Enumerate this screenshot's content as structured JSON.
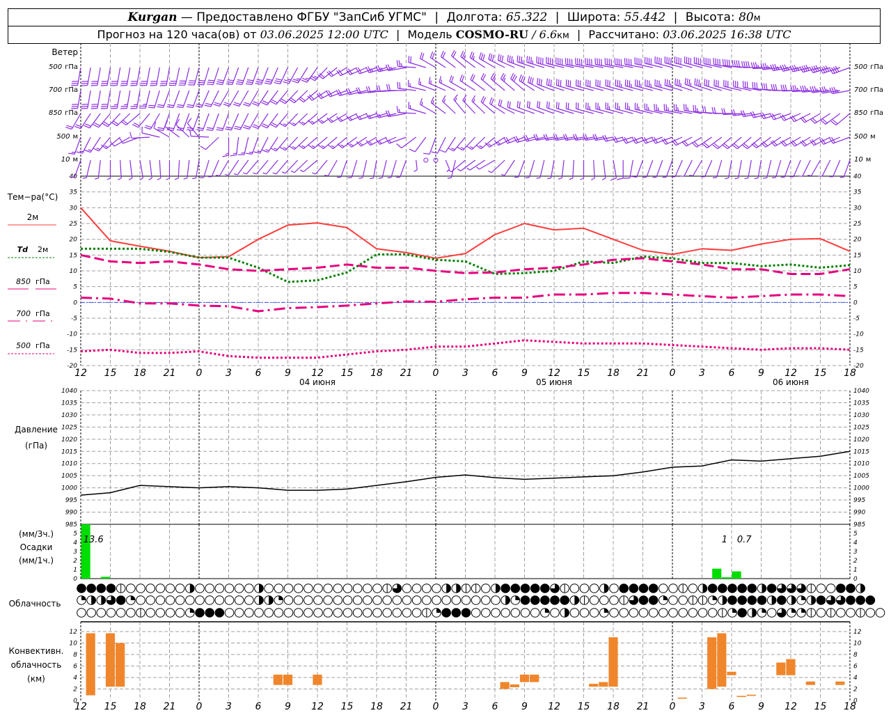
{
  "header": {
    "city": "Kurgan",
    "provider": "— Предоставлено ФГБУ \"ЗапСиб УГМС\"",
    "sep": "|",
    "lon_label": "Долгота:",
    "lon": "65.322",
    "lat_label": "Широта:",
    "lat": "55.442",
    "alt_label": "Высота:",
    "alt": "80",
    "alt_unit": "м",
    "forecast_prefix": "Прогноз на 120 часа(ов) от",
    "forecast_start": "03.06.2025 12:00 UTC",
    "model_label": "Модель",
    "model": "COSMO-RU",
    "model_sep": "/",
    "resolution": "6.6",
    "res_unit": "км",
    "calc_label": "Рассчитано:",
    "calc_time": "03.06.2025 16:38 UTC"
  },
  "time_axis": {
    "tick_labels": [
      "12",
      "15",
      "18",
      "21",
      "0",
      "3",
      "6",
      "9",
      "12",
      "15",
      "18",
      "21",
      "0",
      "3",
      "6",
      "9",
      "12",
      "15",
      "18",
      "21",
      "0",
      "3",
      "6",
      "9",
      "12",
      "15",
      "18"
    ],
    "dates": [
      "04 июня",
      "05 июня",
      "06 июня"
    ]
  },
  "wind": {
    "title": "Ветер",
    "color": "#8a2be2",
    "levels": [
      {
        "value": "500",
        "unit": "гПа"
      },
      {
        "value": "700",
        "unit": "гПа"
      },
      {
        "value": "850",
        "unit": "гПа"
      },
      {
        "value": "500",
        "unit": "м"
      },
      {
        "value": "10",
        "unit": "м"
      }
    ],
    "series": [
      {
        "dir": [
          190,
          190,
          190,
          190,
          195,
          200,
          200,
          205,
          215,
          240,
          250,
          260,
          300,
          310,
          300,
          290,
          285,
          280,
          280,
          280,
          285,
          285,
          280,
          270,
          260,
          255,
          250
        ],
        "speed": [
          15,
          15,
          15,
          15,
          15,
          15,
          15,
          15,
          13,
          12,
          12,
          14,
          10,
          12,
          15,
          18,
          20,
          20,
          22,
          22,
          22,
          22,
          20,
          20,
          18,
          20,
          20
        ]
      },
      {
        "dir": [
          190,
          190,
          190,
          200,
          200,
          210,
          210,
          220,
          230,
          250,
          260,
          270,
          290,
          300,
          310,
          310,
          290,
          285,
          285,
          285,
          285,
          290,
          285,
          280,
          270,
          265,
          260
        ],
        "speed": [
          15,
          15,
          13,
          12,
          12,
          12,
          12,
          12,
          10,
          10,
          10,
          12,
          8,
          10,
          12,
          15,
          15,
          15,
          17,
          18,
          18,
          18,
          17,
          17,
          17,
          18,
          18
        ]
      },
      {
        "dir": [
          210,
          220,
          230,
          200,
          200,
          200,
          210,
          220,
          230,
          240,
          250,
          260,
          300,
          320,
          310,
          290,
          290,
          285,
          285,
          285,
          280,
          280,
          270,
          260,
          250,
          240,
          230
        ],
        "speed": [
          10,
          10,
          10,
          10,
          10,
          10,
          10,
          10,
          8,
          8,
          8,
          10,
          8,
          8,
          10,
          12,
          12,
          12,
          13,
          13,
          13,
          13,
          12,
          12,
          12,
          12,
          12
        ]
      },
      {
        "dir": [
          200,
          220,
          250,
          300,
          320,
          180,
          200,
          220,
          230,
          230,
          240,
          250,
          200,
          220,
          230,
          250,
          260,
          260,
          260,
          250,
          250,
          240,
          230,
          230,
          240,
          240,
          250
        ],
        "speed": [
          8,
          8,
          7,
          7,
          6,
          8,
          8,
          8,
          8,
          8,
          8,
          8,
          6,
          8,
          8,
          10,
          10,
          10,
          10,
          10,
          10,
          10,
          10,
          10,
          10,
          10,
          10
        ]
      },
      {
        "dir": [
          200,
          180,
          170,
          180,
          190,
          210,
          220,
          220,
          230,
          200,
          190,
          200,
          120,
          230,
          240,
          200,
          190,
          180,
          170,
          200,
          200,
          210,
          190,
          190,
          200,
          210,
          200
        ],
        "speed": [
          4,
          4,
          3,
          3,
          3,
          4,
          4,
          4,
          4,
          4,
          4,
          3,
          2,
          4,
          4,
          4,
          4,
          4,
          5,
          5,
          4,
          4,
          4,
          4,
          4,
          4,
          4
        ]
      }
    ]
  },
  "chart_data": [
    {
      "type": "line",
      "ylabel": "Тем−ра(°C)",
      "ylim": [
        -20,
        40
      ],
      "yticks": [
        -20,
        -15,
        -10,
        -5,
        0,
        5,
        10,
        15,
        20,
        25,
        30,
        35,
        40
      ],
      "grid": true,
      "hours": [
        0,
        3,
        6,
        9,
        12,
        15,
        18,
        21,
        24,
        27,
        30,
        33,
        36,
        39,
        42,
        45,
        48,
        51,
        54,
        57,
        60,
        63,
        66,
        69,
        72,
        75,
        78
      ],
      "series": [
        {
          "name": "2м",
          "color": "#ff3c3c",
          "style": "solid",
          "values": [
            30,
            19.5,
            17.8,
            16.2,
            14.2,
            14.5,
            20,
            24.5,
            25.2,
            23.7,
            17,
            15.8,
            14,
            15.5,
            21.5,
            25,
            23,
            23.5,
            20,
            16.5,
            15.2,
            17,
            16.5,
            18.5,
            20,
            20.2,
            16.2
          ]
        },
        {
          "name": "Td",
          "name_suffix": "2м",
          "color": "#008000",
          "style": "dotted",
          "values": [
            17,
            17,
            17,
            16,
            14.2,
            14.2,
            11,
            6.5,
            7,
            9.5,
            15.2,
            15.2,
            13.5,
            13,
            9,
            9.3,
            10,
            13,
            12.5,
            14.5,
            14,
            12.5,
            12.5,
            11.5,
            12,
            11,
            11.8
          ]
        },
        {
          "name": "850",
          "name_suffix": "гПа",
          "color": "#e6007e",
          "style": "dashed",
          "values": [
            15,
            13,
            12.5,
            13,
            12,
            10.5,
            10,
            10.5,
            11,
            12,
            11,
            11,
            10,
            9.3,
            9.5,
            10.5,
            11,
            12,
            13.5,
            14,
            13,
            12,
            10.5,
            10.5,
            9,
            9,
            10.5
          ]
        },
        {
          "name": "700",
          "name_suffix": "гПа",
          "color": "#e6007e",
          "style": "dashdot",
          "values": [
            1.5,
            1.2,
            -0.3,
            -0.3,
            -1,
            -1.2,
            -2.8,
            -1.8,
            -1.5,
            -1,
            -0.3,
            0.3,
            0.2,
            1,
            1.5,
            1.5,
            2.5,
            2.5,
            3,
            3,
            2.5,
            2,
            1.5,
            2,
            2.5,
            2.5,
            2
          ]
        },
        {
          "name": "500",
          "name_suffix": "гПа",
          "color": "#e6007e",
          "style": "dotted",
          "values": [
            -15.5,
            -15,
            -16,
            -16,
            -15.5,
            -17,
            -17.5,
            -17.5,
            -17.5,
            -16.5,
            -15.5,
            -15,
            -14,
            -14,
            -13,
            -12,
            -12.5,
            -13,
            -13,
            -13,
            -13.5,
            -14,
            -14.5,
            -15,
            -14.5,
            -14.5,
            -15
          ]
        }
      ]
    },
    {
      "type": "line",
      "ylabel": "Давление",
      "yunit": "(гПа)",
      "ylim": [
        985,
        1040
      ],
      "yticks": [
        985,
        990,
        995,
        1000,
        1005,
        1010,
        1015,
        1020,
        1025,
        1030,
        1035,
        1040
      ],
      "grid": true,
      "hours": [
        0,
        3,
        6,
        9,
        12,
        15,
        18,
        21,
        24,
        27,
        30,
        33,
        36,
        39,
        42,
        45,
        48,
        51,
        54,
        57,
        60,
        63,
        66,
        69,
        72,
        75,
        78
      ],
      "series": [
        {
          "color": "#000000",
          "values": [
            997,
            998,
            1001,
            1000.5,
            1000,
            1000.5,
            1000,
            999,
            999,
            999.5,
            1001,
            1002.5,
            1004.3,
            1005.3,
            1004.2,
            1003.5,
            1004,
            1004.5,
            1005,
            1006.5,
            1008.5,
            1009,
            1011.5,
            1011,
            1012,
            1013,
            1015
          ]
        }
      ]
    },
    {
      "type": "bar",
      "ylabel_lines": [
        "(мм/3ч.)",
        "Осадки",
        "(мм/1ч.)"
      ],
      "ylim": [
        0,
        6
      ],
      "yticks": [
        0,
        1,
        2,
        3,
        4,
        5
      ],
      "color": "#00dd00",
      "bars": [
        {
          "hour": 1,
          "value": 13.6
        },
        {
          "hour": 3,
          "value": 0.2
        },
        {
          "hour": 65,
          "value": 1.1
        },
        {
          "hour": 66,
          "value": 0.15
        },
        {
          "hour": 67,
          "value": 0.8
        }
      ],
      "annotations": [
        {
          "hour": 1,
          "text": "13.6"
        },
        {
          "hour": 65,
          "text": "1"
        },
        {
          "hour": 67,
          "text": "0.7"
        }
      ]
    },
    {
      "type": "table",
      "ylabel": "Облачность",
      "legend": "0 clear, l trace, 1 quarter, 2 half, 3 three-quarter, 4 overcast",
      "rows": [
        "4444l00000020000002000000000000l3000022ll02444443l00020444400l024444424333l00442",
        "122341000000000000221000000000000000000000021444442l000l344100ll12444424212433444",
        "000000l0000144400000000000000000000l14440000000102000100000000000l14210311l0l00l00"
      ]
    },
    {
      "type": "bar",
      "ylabel_lines": [
        "Конвективн.",
        "облачность",
        "(км)"
      ],
      "ylim": [
        0,
        13
      ],
      "yticks": [
        0,
        2,
        4,
        6,
        8,
        10,
        12
      ],
      "color": "#f0862c",
      "bars": [
        {
          "hour": 1,
          "base": 0.9,
          "top": 11.7
        },
        {
          "hour": 3,
          "base": 2.4,
          "top": 11.7
        },
        {
          "hour": 4,
          "base": 2.4,
          "top": 10
        },
        {
          "hour": 20,
          "base": 2.7,
          "top": 4.5
        },
        {
          "hour": 21,
          "base": 2.7,
          "top": 4.5
        },
        {
          "hour": 24,
          "base": 2.7,
          "top": 4.5
        },
        {
          "hour": 43,
          "base": 2.0,
          "top": 3.2
        },
        {
          "hour": 44,
          "base": 2.3,
          "top": 2.8
        },
        {
          "hour": 45,
          "base": 3.2,
          "top": 4.5
        },
        {
          "hour": 46,
          "base": 3.2,
          "top": 4.5
        },
        {
          "hour": 52,
          "base": 2.4,
          "top": 2.9
        },
        {
          "hour": 53,
          "base": 2.4,
          "top": 3.2
        },
        {
          "hour": 54,
          "base": 2.4,
          "top": 11
        },
        {
          "hour": 61,
          "base": 0.3,
          "top": 0.5
        },
        {
          "hour": 64,
          "base": 2.0,
          "top": 11
        },
        {
          "hour": 65,
          "base": 2.4,
          "top": 11.7
        },
        {
          "hour": 66,
          "base": 4.4,
          "top": 5.0
        },
        {
          "hour": 67,
          "base": 0.6,
          "top": 0.8
        },
        {
          "hour": 68,
          "base": 0.8,
          "top": 1.0
        },
        {
          "hour": 71,
          "base": 4.4,
          "top": 6.6
        },
        {
          "hour": 72,
          "base": 4.4,
          "top": 7.2
        },
        {
          "hour": 74,
          "base": 2.7,
          "top": 3.3
        },
        {
          "hour": 77,
          "base": 2.7,
          "top": 3.3
        }
      ]
    }
  ]
}
